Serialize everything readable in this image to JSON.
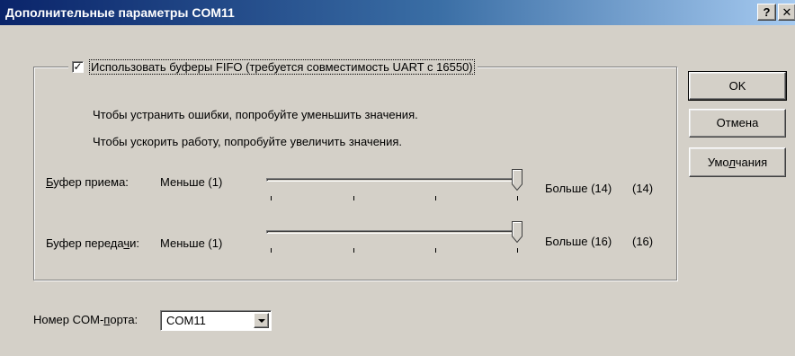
{
  "window": {
    "title": "Дополнительные параметры COM11",
    "help_label": "?",
    "close_label": "✕"
  },
  "fifo": {
    "checkbox_mark": "✓",
    "label": "Использовать буферы FIFO (требуется совместимость UART с 16550)",
    "hint_fix": "Чтобы устранить ошибки, попробуйте уменьшить значения.",
    "hint_speed": "Чтобы ускорить работу, попробуйте увеличить значения."
  },
  "receive": {
    "label_u": "Б",
    "label_rest": "уфер приема:",
    "min_label": "Меньше (1)",
    "max_label": "Больше (14)",
    "value_text": "(14)",
    "value": 14,
    "max": 14
  },
  "transmit": {
    "label_pre": "Буфер переда",
    "label_u": "ч",
    "label_post": "и:",
    "min_label": "Меньше (1)",
    "max_label": "Больше (16)",
    "value_text": "(16)",
    "value": 16,
    "max": 16
  },
  "port": {
    "label_pre": "Номер COM-",
    "label_u": "п",
    "label_post": "орта:",
    "value": "COM11"
  },
  "buttons": {
    "ok": "OK",
    "cancel": "Отмена",
    "defaults_pre": "Умо",
    "defaults_u": "л",
    "defaults_post": "чания"
  }
}
